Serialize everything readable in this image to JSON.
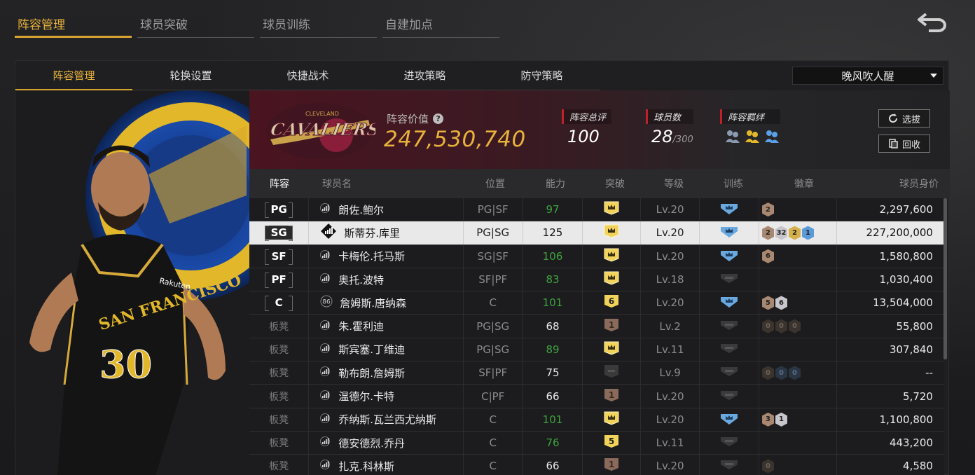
{
  "top_tabs": [
    "阵容管理",
    "球员突破",
    "球员训练",
    "自建加点"
  ],
  "sub_tabs": [
    "阵容管理",
    "轮换设置",
    "快捷战术",
    "进攻策略",
    "防守策略"
  ],
  "lineup_select": {
    "value": "晚风吹人醒"
  },
  "team": {
    "value_label": "阵容价值",
    "value": "247,530,740",
    "overall_label": "阵容总评",
    "overall": "100",
    "players_label": "球员数",
    "players": "28",
    "players_max": "/300",
    "bond_label": "阵容羁绊",
    "select_btn": "选拔",
    "recycle_btn": "回收",
    "logo_text": "CAVALIERS",
    "logo_sub": "CLEVELAND"
  },
  "player_card": {
    "jersey_text": "SAN FRANCISCO",
    "number": "30",
    "sponsor": "Rakuten"
  },
  "table": {
    "headers": [
      "阵容",
      "球员名",
      "位置",
      "能力",
      "突破",
      "等级",
      "训练",
      "徽章",
      "球员身价"
    ],
    "rows": [
      {
        "lineup": "PG",
        "name": "朗佐.鲍尔",
        "pos": "PG|SF",
        "ability": "97",
        "ability_green": true,
        "breakthrough": "crown",
        "level": "Lv.20",
        "training": true,
        "badges": [
          [
            "b-bronze",
            "2"
          ]
        ],
        "price": "2,297,600"
      },
      {
        "lineup": "SG",
        "name": "斯蒂芬.库里",
        "pos": "PG|SG",
        "ability": "125",
        "ability_green": false,
        "breakthrough": "crown",
        "level": "Lv.20",
        "training": true,
        "badges": [
          [
            "b-bronze",
            "2"
          ],
          [
            "b-silver",
            "32"
          ],
          [
            "b-gold",
            "2"
          ],
          [
            "b-blue",
            "1"
          ]
        ],
        "price": "227,200,000",
        "selected": true
      },
      {
        "lineup": "SF",
        "name": "卡梅伦.托马斯",
        "pos": "SG|SF",
        "ability": "106",
        "ability_green": true,
        "breakthrough": "crown",
        "level": "Lv.20",
        "training": true,
        "badges": [
          [
            "b-bronze",
            "6"
          ]
        ],
        "price": "1,580,800"
      },
      {
        "lineup": "PF",
        "name": "奥托.波特",
        "pos": "SF|PF",
        "ability": "83",
        "ability_green": true,
        "breakthrough": "crown",
        "level": "Lv.18",
        "training": false,
        "badges": [],
        "price": "1,030,400"
      },
      {
        "lineup": "C",
        "name": "詹姆斯.唐纳森",
        "pos": "C",
        "ability": "101",
        "ability_green": true,
        "breakthrough": "6",
        "level": "Lv.20",
        "training": true,
        "badges": [
          [
            "b-bronze",
            "5"
          ],
          [
            "b-silver",
            "6"
          ]
        ],
        "price": "13,504,000",
        "icon86": "86"
      },
      {
        "lineup": "板凳",
        "name": "朱.霍利迪",
        "pos": "PG|SG",
        "ability": "68",
        "ability_green": false,
        "breakthrough": "1",
        "level": "Lv.2",
        "training": false,
        "badges": [
          [
            "b-dark",
            "0"
          ],
          [
            "b-dark",
            "0"
          ],
          [
            "b-dark",
            "0"
          ]
        ],
        "price": "55,800"
      },
      {
        "lineup": "板凳",
        "name": "斯宾塞.丁维迪",
        "pos": "PG|SG",
        "ability": "89",
        "ability_green": true,
        "breakthrough": "crown",
        "level": "Lv.11",
        "training": false,
        "badges": [],
        "price": "307,840"
      },
      {
        "lineup": "板凳",
        "name": "勒布朗.詹姆斯",
        "pos": "SF|PF",
        "ability": "75",
        "ability_green": false,
        "breakthrough": "none",
        "level": "Lv.9",
        "training": false,
        "badges": [
          [
            "b-dark",
            "0"
          ],
          [
            "b-darkb",
            "0"
          ],
          [
            "b-darkb",
            "0"
          ]
        ],
        "price": "--"
      },
      {
        "lineup": "板凳",
        "name": "温德尔.卡特",
        "pos": "C|PF",
        "ability": "66",
        "ability_green": false,
        "breakthrough": "1",
        "level": "Lv.20",
        "training": false,
        "badges": [],
        "price": "5,720"
      },
      {
        "lineup": "板凳",
        "name": "乔纳斯.瓦兰西尤纳斯",
        "pos": "C",
        "ability": "101",
        "ability_green": true,
        "breakthrough": "crown",
        "level": "Lv.20",
        "training": true,
        "badges": [
          [
            "b-bronze",
            "3"
          ],
          [
            "b-silver",
            "1"
          ]
        ],
        "price": "1,100,800"
      },
      {
        "lineup": "板凳",
        "name": "德安德烈.乔丹",
        "pos": "C",
        "ability": "76",
        "ability_green": true,
        "breakthrough": "5",
        "level": "Lv.11",
        "training": false,
        "badges": [],
        "price": "443,200"
      },
      {
        "lineup": "板凳",
        "name": "扎克.科林斯",
        "pos": "C",
        "ability": "66",
        "ability_green": false,
        "breakthrough": "1",
        "level": "Lv.20",
        "training": false,
        "badges": [
          [
            "b-dark",
            "0"
          ]
        ],
        "price": "4,580"
      }
    ]
  },
  "colors": {
    "accent": "#e8b23c",
    "team_red": "#6b1a2a",
    "selected_row": "#e9e9ea"
  }
}
